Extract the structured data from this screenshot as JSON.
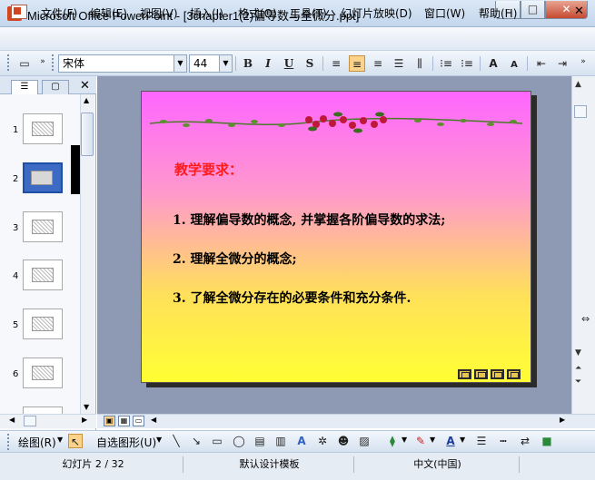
{
  "window": {
    "title": "Microsoft Office PowerPoint - [3chapter1(2)偏导数与全微分.ppt]",
    "icon": "powerpoint-app-icon",
    "minimize": "–",
    "maximize": "□",
    "close": "✕"
  },
  "menubar": {
    "items": [
      "文件(F)",
      "编辑(E)",
      "视图(V)",
      "插入(I)",
      "格式(O)",
      "工具(T)",
      "幻灯片放映(D)",
      "窗口(W)",
      "帮助(H)"
    ],
    "close": "✕"
  },
  "format_toolbar": {
    "font_name": "宋体",
    "font_size": "44",
    "bold": "B",
    "italic": "I",
    "underline": "U",
    "shadow": "S",
    "font_color_label": "A"
  },
  "outline_pane": {
    "tabs": [
      "outline-tab",
      "slides-tab"
    ],
    "close": "✕",
    "slide_numbers": [
      "1",
      "2",
      "3",
      "4",
      "5",
      "6"
    ],
    "selected_slide": "2"
  },
  "slide": {
    "heading": "教学要求：",
    "bullets": [
      "1. 理解偏导数的概念, 并掌握各阶偏导数的求法;",
      "2. 理解全微分的概念;",
      "3. 了解全微分存在的必要条件和充分条件."
    ]
  },
  "draw_toolbar": {
    "draw_label": "绘图(R)",
    "autoshapes_label": "自选图形(U)"
  },
  "statusbar": {
    "slide_info": "幻灯片 2 / 32",
    "template": "默认设计模板",
    "language": "中文(中国)"
  },
  "colors": {
    "heading_red": "#ff1a1a",
    "slide_top": "#ff66ff",
    "slide_bottom": "#ffff33",
    "workspace": "#8e9ab4"
  }
}
